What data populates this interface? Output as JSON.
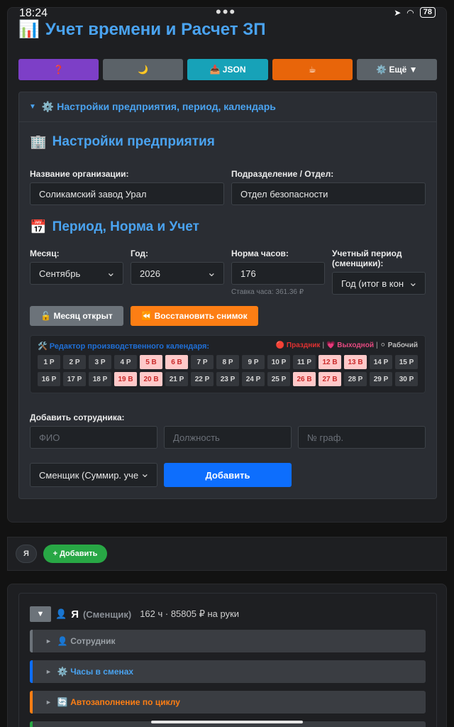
{
  "status": {
    "time": "18:24",
    "battery": "78"
  },
  "app": {
    "title": "Учет времени и Расчет ЗП",
    "title_icon": "📊"
  },
  "toolbar": {
    "help": "❓",
    "theme": "🌙",
    "json": "📥 JSON",
    "coffee": "☕",
    "more": "⚙️ Ещё ▼"
  },
  "settings": {
    "panel_header": "⚙️ Настройки предприятия, период, календарь",
    "org_section_title": "Настройки предприятия",
    "org_section_icon": "🏢",
    "org_label": "Название организации:",
    "org_value": "Соликамский завод Урал",
    "dept_label": "Подразделение / Отдел:",
    "dept_value": "Отдел безопасности",
    "period_section_title": "Период, Норма и Учет",
    "period_section_icon": "📅",
    "month_label": "Месяц:",
    "month_value": "Сентябрь",
    "year_label": "Год:",
    "year_value": "2026",
    "norm_label": "Норма часов:",
    "norm_value": "176",
    "rate_hint": "Ставка часа: 361.36 ₽",
    "acc_label": "Учетный период (сменщики):",
    "acc_value": "Год (итог в кон",
    "month_open_btn": "🔓 Месяц открыт",
    "restore_btn": "⏪ Восстановить снимок"
  },
  "calendar": {
    "title": "🛠️ Редактор производственного календаря:",
    "legend_holiday": "🔴 Праздник",
    "legend_sep1": "|",
    "legend_off": "💗 Выходной",
    "legend_sep2": "|",
    "legend_work": "⚪ Рабочий",
    "days": [
      {
        "label": "1 Р",
        "off": false
      },
      {
        "label": "2 Р",
        "off": false
      },
      {
        "label": "3 Р",
        "off": false
      },
      {
        "label": "4 Р",
        "off": false
      },
      {
        "label": "5 В",
        "off": true
      },
      {
        "label": "6 В",
        "off": true
      },
      {
        "label": "7 Р",
        "off": false
      },
      {
        "label": "8 Р",
        "off": false
      },
      {
        "label": "9 Р",
        "off": false
      },
      {
        "label": "10 Р",
        "off": false
      },
      {
        "label": "11 Р",
        "off": false
      },
      {
        "label": "12 В",
        "off": true
      },
      {
        "label": "13 В",
        "off": true
      },
      {
        "label": "14 Р",
        "off": false
      },
      {
        "label": "15 Р",
        "off": false
      },
      {
        "label": "16 Р",
        "off": false
      },
      {
        "label": "17 Р",
        "off": false
      },
      {
        "label": "18 Р",
        "off": false
      },
      {
        "label": "19 В",
        "off": true
      },
      {
        "label": "20 В",
        "off": true
      },
      {
        "label": "21 Р",
        "off": false
      },
      {
        "label": "22 Р",
        "off": false
      },
      {
        "label": "23 Р",
        "off": false
      },
      {
        "label": "24 Р",
        "off": false
      },
      {
        "label": "25 Р",
        "off": false
      },
      {
        "label": "26 В",
        "off": true
      },
      {
        "label": "27 В",
        "off": true
      },
      {
        "label": "28 Р",
        "off": false
      },
      {
        "label": "29 Р",
        "off": false
      },
      {
        "label": "30 Р",
        "off": false
      }
    ]
  },
  "add_employee": {
    "label": "Добавить сотрудника:",
    "name_placeholder": "ФИО",
    "position_placeholder": "Должность",
    "schedule_placeholder": "№ граф.",
    "type_value": "Сменщик (Суммир. уче",
    "add_btn": "Добавить"
  },
  "chips": {
    "me": "Я",
    "add": "+ Добавить"
  },
  "employee": {
    "toggle": "▼",
    "icon": "👤",
    "name": "Я",
    "type": "(Сменщик)",
    "summary": "162 ч · 85805 ₽ на руки",
    "sections": {
      "employee": "👤 Сотрудник",
      "hours": "⚙️ Часы в сменах",
      "autofill": "🔄 Автозаполнение по циклу",
      "next": "⛔"
    }
  }
}
